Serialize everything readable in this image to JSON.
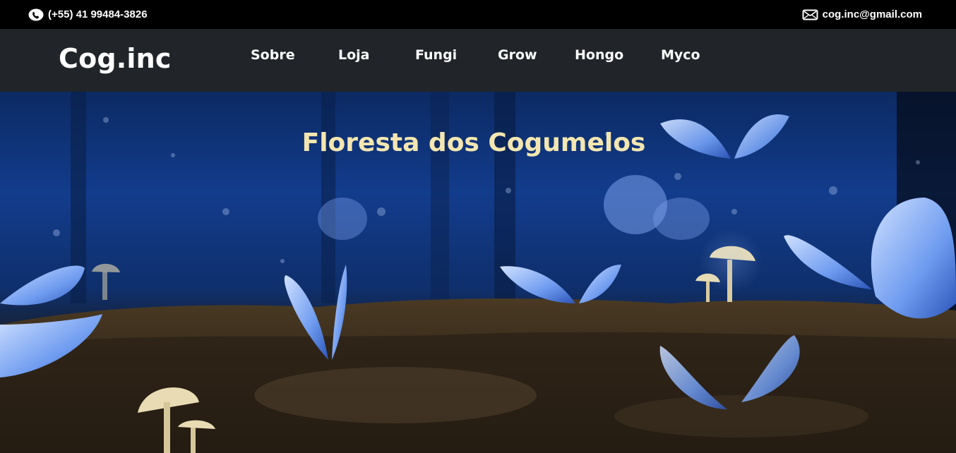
{
  "topbar": {
    "phone": "(+55) 41 99484-3826",
    "email": "cog.inc@gmail.com"
  },
  "navbar": {
    "brand": "Cog.inc",
    "items": [
      {
        "label": "Sobre"
      },
      {
        "label": "Loja"
      },
      {
        "label": "Fungi"
      },
      {
        "label": "Grow"
      },
      {
        "label": "Hongo"
      },
      {
        "label": "Myco"
      }
    ]
  },
  "hero": {
    "title": "Floresta dos Cogumelos"
  },
  "icons": {
    "phone": "phone-icon",
    "email": "envelope-icon"
  },
  "colors": {
    "topbar_bg": "#000000",
    "navbar_bg": "#212529",
    "hero_title": "#f3e6b0"
  }
}
